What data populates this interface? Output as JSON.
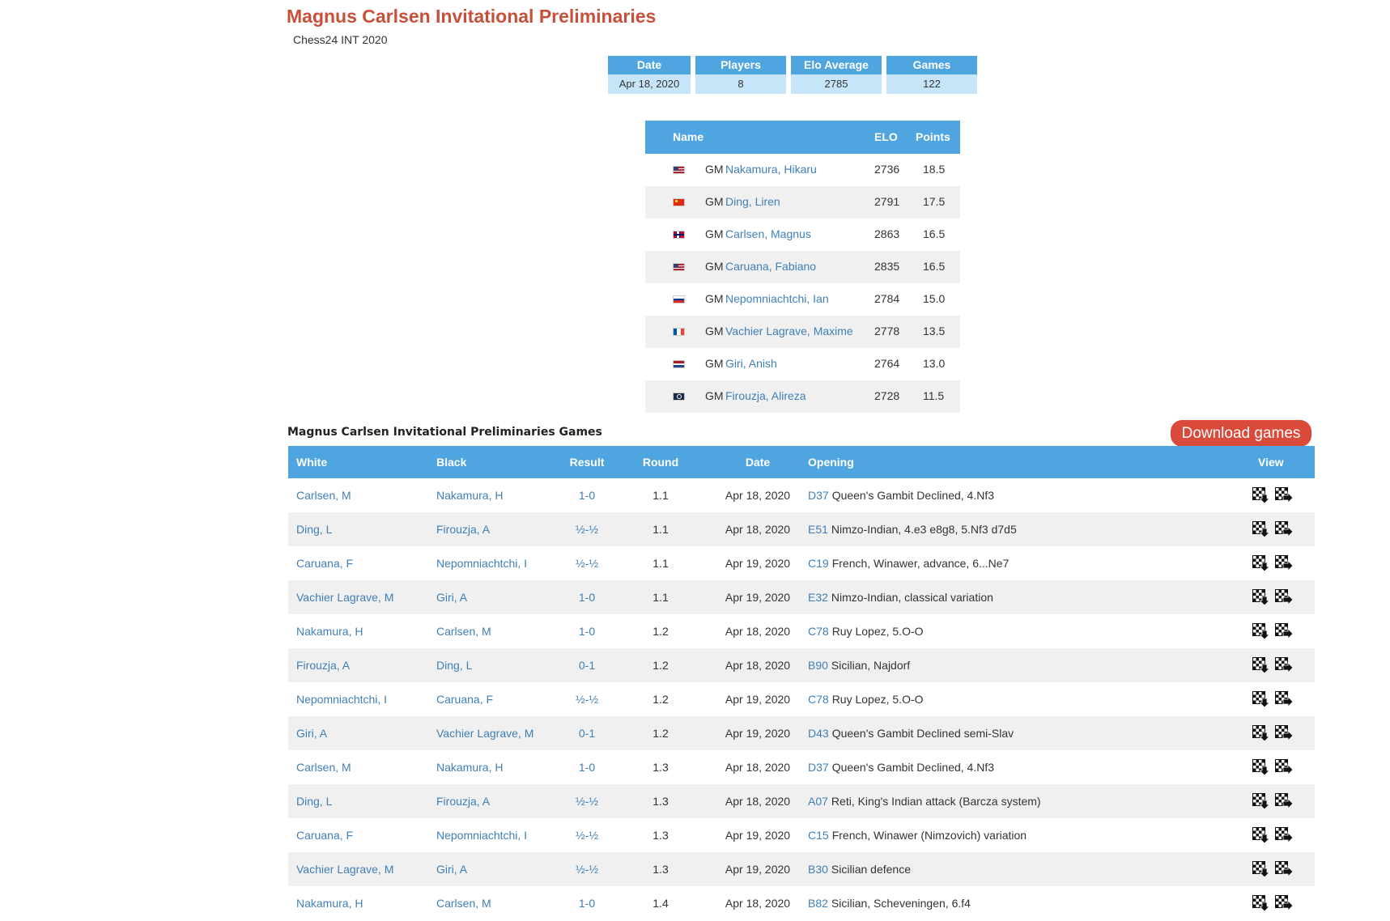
{
  "page": {
    "title": "Magnus Carlsen Invitational Preliminaries",
    "subtitle": "Chess24 INT 2020"
  },
  "stats": [
    {
      "label": "Date",
      "value": "Apr 18, 2020"
    },
    {
      "label": "Players",
      "value": "8"
    },
    {
      "label": "Elo Average",
      "value": "2785"
    },
    {
      "label": "Games",
      "value": "122"
    }
  ],
  "players_table": {
    "headers": {
      "name": "Name",
      "elo": "ELO",
      "points": "Points"
    },
    "rows": [
      {
        "flag": "us-flag-icon",
        "title": "GM",
        "name": "Nakamura, Hikaru",
        "elo": "2736",
        "points": "18.5"
      },
      {
        "flag": "cn-flag-icon",
        "title": "GM",
        "name": "Ding, Liren",
        "elo": "2791",
        "points": "17.5"
      },
      {
        "flag": "no-flag-icon",
        "title": "GM",
        "name": "Carlsen, Magnus",
        "elo": "2863",
        "points": "16.5"
      },
      {
        "flag": "us-flag-icon",
        "title": "GM",
        "name": "Caruana, Fabiano",
        "elo": "2835",
        "points": "16.5"
      },
      {
        "flag": "ru-flag-icon",
        "title": "GM",
        "name": "Nepomniachtchi, Ian",
        "elo": "2784",
        "points": "15.0"
      },
      {
        "flag": "fr-flag-icon",
        "title": "GM",
        "name": "Vachier Lagrave, Maxime",
        "elo": "2778",
        "points": "13.5"
      },
      {
        "flag": "nl-flag-icon",
        "title": "GM",
        "name": "Giri, Anish",
        "elo": "2764",
        "points": "13.0"
      },
      {
        "flag": "fide-flag-icon",
        "title": "GM",
        "name": "Firouzja, Alireza",
        "elo": "2728",
        "points": "11.5"
      }
    ]
  },
  "games_section": {
    "title": "Magnus Carlsen Invitational Preliminaries Games",
    "download_label": "Download games",
    "headers": {
      "white": "White",
      "black": "Black",
      "result": "Result",
      "round": "Round",
      "date": "Date",
      "opening": "Opening",
      "view": "View"
    },
    "view_icons": [
      "download-board-icon",
      "open-board-icon"
    ],
    "rows": [
      {
        "white": "Carlsen, M",
        "black": "Nakamura, H",
        "result": "1-0",
        "round": "1.1",
        "date": "Apr 18, 2020",
        "eco": "D37",
        "opening": "Queen's Gambit Declined, 4.Nf3"
      },
      {
        "white": "Ding, L",
        "black": "Firouzja, A",
        "result": "½-½",
        "round": "1.1",
        "date": "Apr 18, 2020",
        "eco": "E51",
        "opening": "Nimzo-Indian, 4.e3 e8g8, 5.Nf3 d7d5"
      },
      {
        "white": "Caruana, F",
        "black": "Nepomniachtchi, I",
        "result": "½-½",
        "round": "1.1",
        "date": "Apr 19, 2020",
        "eco": "C19",
        "opening": "French, Winawer, advance, 6...Ne7"
      },
      {
        "white": "Vachier Lagrave, M",
        "black": "Giri, A",
        "result": "1-0",
        "round": "1.1",
        "date": "Apr 19, 2020",
        "eco": "E32",
        "opening": "Nimzo-Indian, classical variation"
      },
      {
        "white": "Nakamura, H",
        "black": "Carlsen, M",
        "result": "1-0",
        "round": "1.2",
        "date": "Apr 18, 2020",
        "eco": "C78",
        "opening": "Ruy Lopez, 5.O-O"
      },
      {
        "white": "Firouzja, A",
        "black": "Ding, L",
        "result": "0-1",
        "round": "1.2",
        "date": "Apr 18, 2020",
        "eco": "B90",
        "opening": "Sicilian, Najdorf"
      },
      {
        "white": "Nepomniachtchi, I",
        "black": "Caruana, F",
        "result": "½-½",
        "round": "1.2",
        "date": "Apr 19, 2020",
        "eco": "C78",
        "opening": "Ruy Lopez, 5.O-O"
      },
      {
        "white": "Giri, A",
        "black": "Vachier Lagrave, M",
        "result": "0-1",
        "round": "1.2",
        "date": "Apr 19, 2020",
        "eco": "D43",
        "opening": "Queen's Gambit Declined semi-Slav"
      },
      {
        "white": "Carlsen, M",
        "black": "Nakamura, H",
        "result": "1-0",
        "round": "1.3",
        "date": "Apr 18, 2020",
        "eco": "D37",
        "opening": "Queen's Gambit Declined, 4.Nf3"
      },
      {
        "white": "Ding, L",
        "black": "Firouzja, A",
        "result": "½-½",
        "round": "1.3",
        "date": "Apr 18, 2020",
        "eco": "A07",
        "opening": "Reti, King's Indian attack (Barcza system)"
      },
      {
        "white": "Caruana, F",
        "black": "Nepomniachtchi, I",
        "result": "½-½",
        "round": "1.3",
        "date": "Apr 19, 2020",
        "eco": "C15",
        "opening": "French, Winawer (Nimzovich) variation"
      },
      {
        "white": "Vachier Lagrave, M",
        "black": "Giri, A",
        "result": "½-½",
        "round": "1.3",
        "date": "Apr 19, 2020",
        "eco": "B30",
        "opening": "Sicilian defence"
      },
      {
        "white": "Nakamura, H",
        "black": "Carlsen, M",
        "result": "1-0",
        "round": "1.4",
        "date": "Apr 18, 2020",
        "eco": "B82",
        "opening": "Sicilian, Scheveningen, 6.f4"
      }
    ]
  }
}
